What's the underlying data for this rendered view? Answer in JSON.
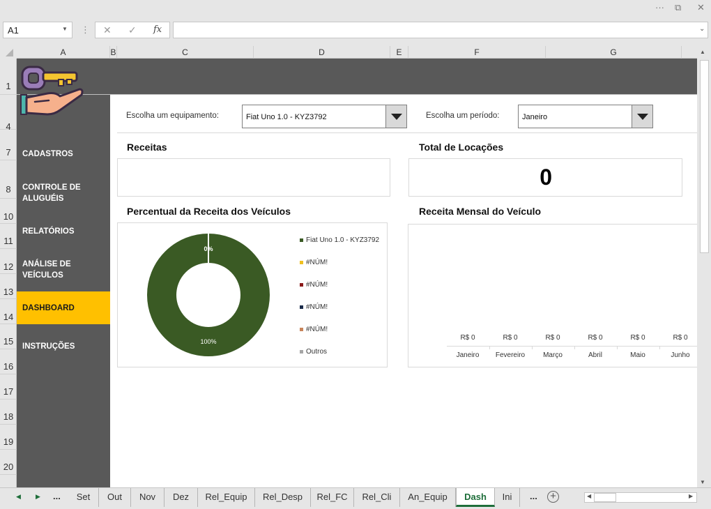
{
  "window": {
    "menu_dots": "···",
    "restore_glyph": "⧉",
    "close_glyph": "✕"
  },
  "formula_bar": {
    "name_box": "A1",
    "separator": "⋮",
    "cancel_glyph": "✕",
    "enter_glyph": "✓",
    "fx_label": "fx",
    "formula": ""
  },
  "columns": [
    "A",
    "B",
    "C",
    "D",
    "E",
    "F",
    "G"
  ],
  "rows": [
    "1",
    "4",
    "7",
    "8",
    "10",
    "11",
    "12",
    "13",
    "14",
    "15",
    "16",
    "17",
    "18",
    "19",
    "20"
  ],
  "sidebar": {
    "items": [
      {
        "label": "CADASTROS"
      },
      {
        "label": "CONTROLE DE ALUGUÉIS"
      },
      {
        "label": "RELATÓRIOS"
      },
      {
        "label": "ANÁLISE DE VEÍCULOS"
      },
      {
        "label": "DASHBOARD",
        "active": true
      },
      {
        "label": "INSTRUÇÕES"
      }
    ]
  },
  "filters": {
    "equipment_label": "Escolha um equipamento:",
    "equipment_value": "Fiat Uno 1.0 - KYZ3792",
    "period_label": "Escolha um período:",
    "period_value": "Janeiro"
  },
  "sections": {
    "receitas_title": "Receitas",
    "total_title": "Total de Locações",
    "total_value": "0",
    "pie_title": "Percentual da Receita dos Veículos",
    "bar_title": "Receita Mensal do Veículo"
  },
  "chart_data": [
    {
      "type": "pie",
      "style": "donut",
      "labels": [
        "Fiat Uno 1.0 - KYZ3792",
        "#NÚM!",
        "#NÚM!",
        "#NÚM!",
        "#NÚM!",
        "Outros"
      ],
      "values": [
        100,
        0,
        0,
        0,
        0,
        0
      ],
      "data_labels": [
        "100%",
        "0%"
      ],
      "colors": [
        "#3a5a24",
        "#f0c020",
        "#8b1a1a",
        "#1a2b4a",
        "#c8845a",
        "#a6a6a6"
      ],
      "legend": "right"
    },
    {
      "type": "bar",
      "categories": [
        "Janeiro",
        "Fevereiro",
        "Março",
        "Abril",
        "Maio",
        "Junho"
      ],
      "values": [
        0,
        0,
        0,
        0,
        0,
        0
      ],
      "data_labels": [
        "R$ 0",
        "R$ 0",
        "R$ 0",
        "R$ 0",
        "R$ 0",
        "R$ 0"
      ]
    }
  ],
  "sheet_tabs": {
    "nav_prev": "◀",
    "nav_next": "▶",
    "ellipsis": "...",
    "tabs": [
      "Set",
      "Out",
      "Nov",
      "Dez",
      "Rel_Equip",
      "Rel_Desp",
      "Rel_FC",
      "Rel_Cli",
      "An_Equip",
      "Dash",
      "Ini"
    ],
    "active": "Dash",
    "add_glyph": "+"
  }
}
